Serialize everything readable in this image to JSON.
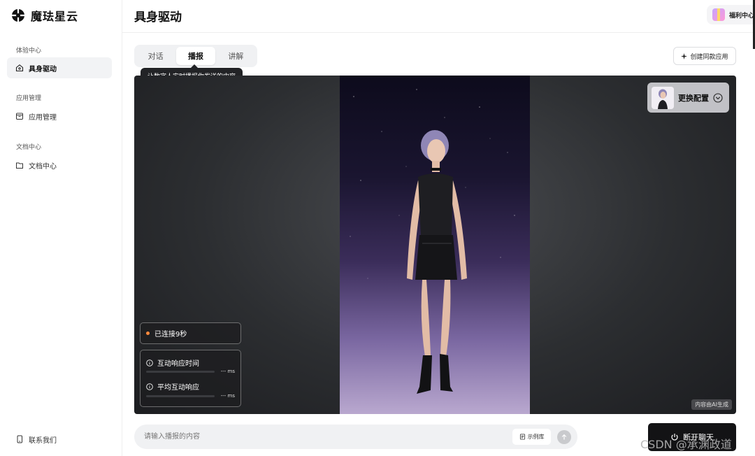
{
  "brand": {
    "name": "魔珐星云"
  },
  "sidebar": {
    "groups": [
      {
        "title": "体验中心",
        "items": [
          {
            "label": "具身驱动",
            "active": true,
            "icon": "home-icon"
          }
        ]
      },
      {
        "title": "应用管理",
        "items": [
          {
            "label": "应用管理",
            "active": false,
            "icon": "box-icon"
          }
        ]
      },
      {
        "title": "文档中心",
        "items": [
          {
            "label": "文档中心",
            "active": false,
            "icon": "folder-icon"
          }
        ]
      }
    ],
    "contact_label": "联系我们"
  },
  "header": {
    "title": "具身驱动",
    "benefit_label": "福利中心"
  },
  "tabs": [
    {
      "label": "对话",
      "active": false
    },
    {
      "label": "播报",
      "active": true
    },
    {
      "label": "讲解",
      "active": false
    }
  ],
  "tooltip": "让数字人实时播报你发送的内容",
  "create_button": "创建同款应用",
  "stage": {
    "config_label": "更换配置",
    "status": "已连接9秒",
    "metrics": [
      {
        "label": "互动响应时间",
        "value": "--- ms"
      },
      {
        "label": "平均互动响应",
        "value": "--- ms"
      }
    ],
    "ai_badge": "内容由AI生成"
  },
  "input": {
    "placeholder": "请输入播报的内容",
    "value": ""
  },
  "example_button": "示例库",
  "chat_button": "断开聊天",
  "watermark": "CSDN @承渊政道",
  "colors": {
    "status_dot": "#ff8a3d",
    "chat_button": "#131315"
  }
}
